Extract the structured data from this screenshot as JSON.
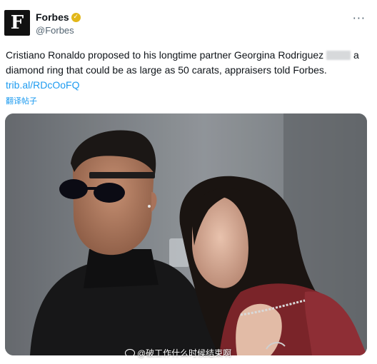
{
  "author": {
    "avatar_letter": "F",
    "display_name": "Forbes",
    "verified_icon": "✓",
    "handle": "@Forbes",
    "more_icon": "···"
  },
  "tweet": {
    "text_before": "Cristiano Ronaldo proposed to his longtime partner Georgina Rodriguez",
    "text_after": "a diamond ring that could be as large as 50 carats, appraisers told Forbes.",
    "link": "trib.al/RDcOoFQ",
    "translate": "翻译帖子"
  },
  "media": {
    "watermark": "@破工作什么时候结束啊"
  },
  "colors": {
    "link": "#1d9bf0",
    "secondary_text": "#536471",
    "verified": "#e2b719"
  }
}
